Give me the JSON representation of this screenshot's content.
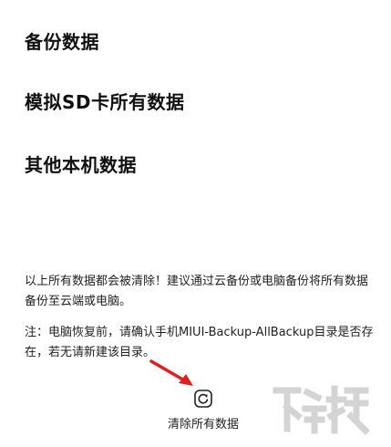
{
  "items": [
    {
      "label": "备份数据"
    },
    {
      "label": "模拟SD卡所有数据"
    },
    {
      "label": "其他本机数据"
    }
  ],
  "warning_text": "以上所有数据都会被清除！建议通过云备份或电脑备份将所有数据备份至云端或电脑。",
  "note_text": "注：电脑恢复前，请确认手机MIUI-Backup-AllBackup目录是否存在，若无请新建该目录。",
  "clear_button": {
    "label": "清除所有数据",
    "icon": "reset-icon"
  },
  "annotation": {
    "icon": "red-arrow-icon",
    "color": "#e02020"
  },
  "watermark": {
    "text": "下载吧",
    "icon": "watermark-logo"
  }
}
